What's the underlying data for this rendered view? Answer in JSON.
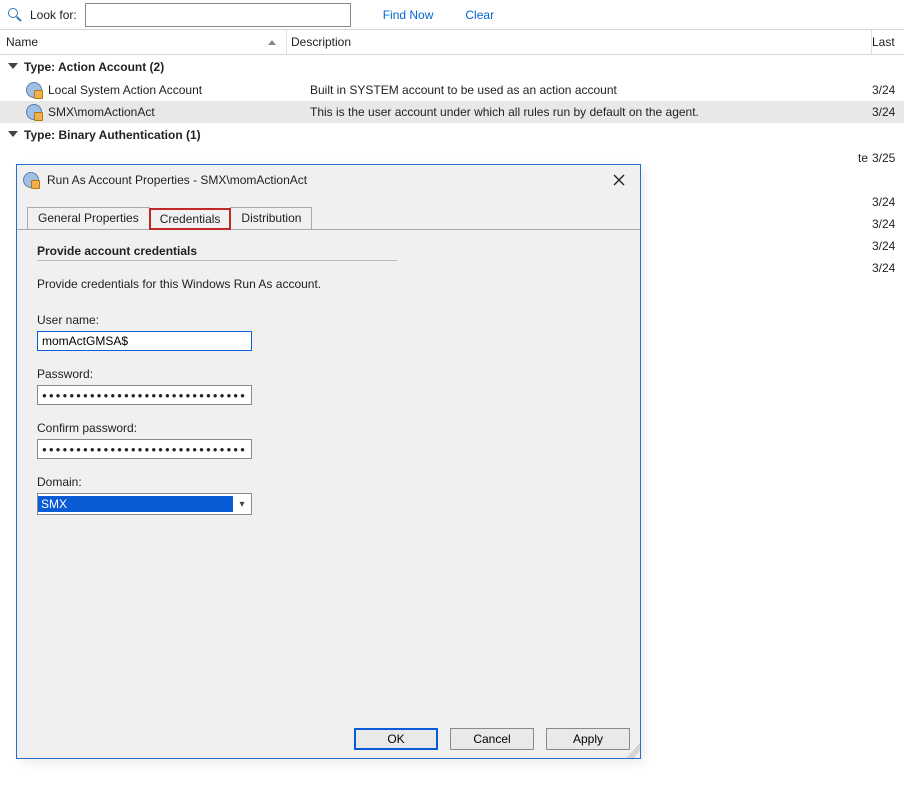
{
  "toolbar": {
    "look_label": "Look for:",
    "find_now": "Find Now",
    "clear": "Clear"
  },
  "columns": {
    "name": "Name",
    "description": "Description",
    "last": "Last"
  },
  "groups": {
    "g0": {
      "label": "Type: Action Account (2)"
    },
    "g1": {
      "label": "Type: Binary Authentication (1)"
    }
  },
  "rows": {
    "r0": {
      "name": "Local System Action Account",
      "desc": "Built in SYSTEM account to be used as an action account",
      "date": "3/24"
    },
    "r1": {
      "name": "SMX\\momActionAct",
      "desc": "This is the user account under which all rules run by default on the agent.",
      "date": "3/24"
    }
  },
  "hidden_dates": {
    "d0": {
      "val": "3/25",
      "suffix_visible": "te"
    },
    "d1": "3/24",
    "d2": "3/24",
    "d3": "3/24",
    "d4": "3/24"
  },
  "dialog": {
    "title": "Run As Account Properties - SMX\\momActionAct",
    "tabs": {
      "general": "General Properties",
      "creds": "Credentials",
      "dist": "Distribution"
    },
    "section_title": "Provide account credentials",
    "helptext": "Provide credentials for this Windows Run As account.",
    "username_label": "User name:",
    "username_value": "momActGMSA$",
    "password_label": "Password:",
    "confirm_label": "Confirm password:",
    "pw_mask": "●●●●●●●●●●●●●●●●●●●●●●●●●●●●●●",
    "domain_label": "Domain:",
    "domain_value": "SMX",
    "ok": "OK",
    "cancel": "Cancel",
    "apply": "Apply"
  }
}
